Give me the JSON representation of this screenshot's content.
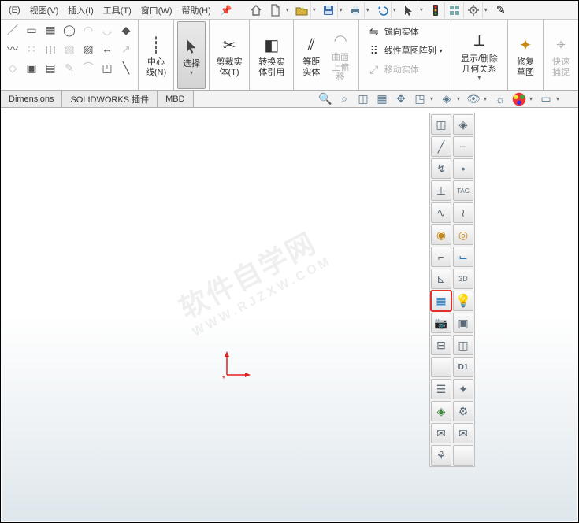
{
  "menu": {
    "items": [
      "(E)",
      "视图(V)",
      "插入(I)",
      "工具(T)",
      "窗口(W)",
      "帮助(H)"
    ]
  },
  "ribbon": {
    "centerline": "中心线(N)",
    "select": "选择",
    "trim": "剪裁实体(T)",
    "convert": "转换实体引用",
    "offset": "等距实体",
    "onsurface": "曲面上偏移",
    "mirror": "镜向实体",
    "linpattern": "线性草图阵列",
    "moveent": "移动实体",
    "showdel": "显示/删除几何关系",
    "repair": "修复草图",
    "quicksnap": "快速捕捉"
  },
  "tabs": {
    "dimensions": "Dimensions",
    "swplugin": "SOLIDWORKS 插件",
    "mbd": "MBD"
  },
  "watermark": {
    "top": "软件自学网",
    "sub": "WWW.RJZXW.COM"
  },
  "vbar": {
    "d1": "D1",
    "tag": "TAG",
    "threed": "3D"
  }
}
